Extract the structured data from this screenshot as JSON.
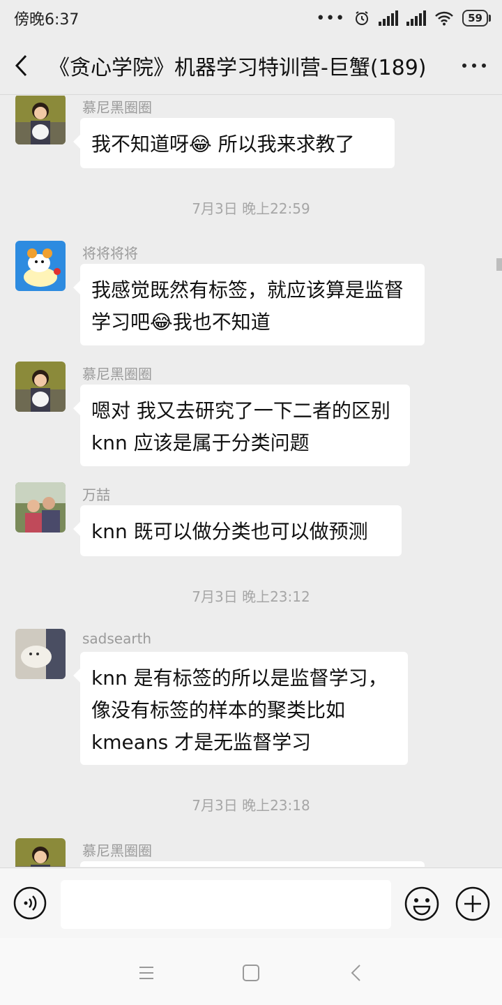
{
  "status_bar": {
    "time": "傍晚6:37",
    "battery": "59"
  },
  "header": {
    "title": "《贪心学院》机器学习特训营-巨蟹(189)"
  },
  "messages": [
    {
      "type": "message",
      "sender": "慕尼黑圈圈",
      "text": "我不知道呀😂 所以我来求教了"
    },
    {
      "type": "time",
      "text": "7月3日 晚上22:59"
    },
    {
      "type": "message",
      "sender": "将将将将",
      "text": "我感觉既然有标签，就应该算是监督学习吧😂我也不知道"
    },
    {
      "type": "message",
      "sender": "慕尼黑圈圈",
      "text": "嗯对 我又去研究了一下二者的区别 knn 应该是属于分类问题"
    },
    {
      "type": "message",
      "sender": "万喆",
      "text": "knn 既可以做分类也可以做预测"
    },
    {
      "type": "time",
      "text": "7月3日 晚上23:12"
    },
    {
      "type": "message",
      "sender": "sadsearth",
      "text": "knn 是有标签的所以是监督学习，像没有标签的样本的聚类比如 kmeans 才是无监督学习"
    },
    {
      "type": "time",
      "text": "7月3日 晚上23:18"
    },
    {
      "type": "message",
      "sender": "慕尼黑圈圈",
      "text": ""
    }
  ],
  "icons": {
    "back": "chevron-left-icon",
    "more": "more-dots-icon",
    "voice": "voice-icon",
    "emoji": "emoji-icon",
    "plus": "plus-icon",
    "nav_menu": "menu-icon",
    "nav_home": "home-icon",
    "nav_back": "back-icon"
  },
  "colors": {
    "background": "#ededed",
    "bubble": "#ffffff",
    "meta_text": "#9a9a9a"
  }
}
